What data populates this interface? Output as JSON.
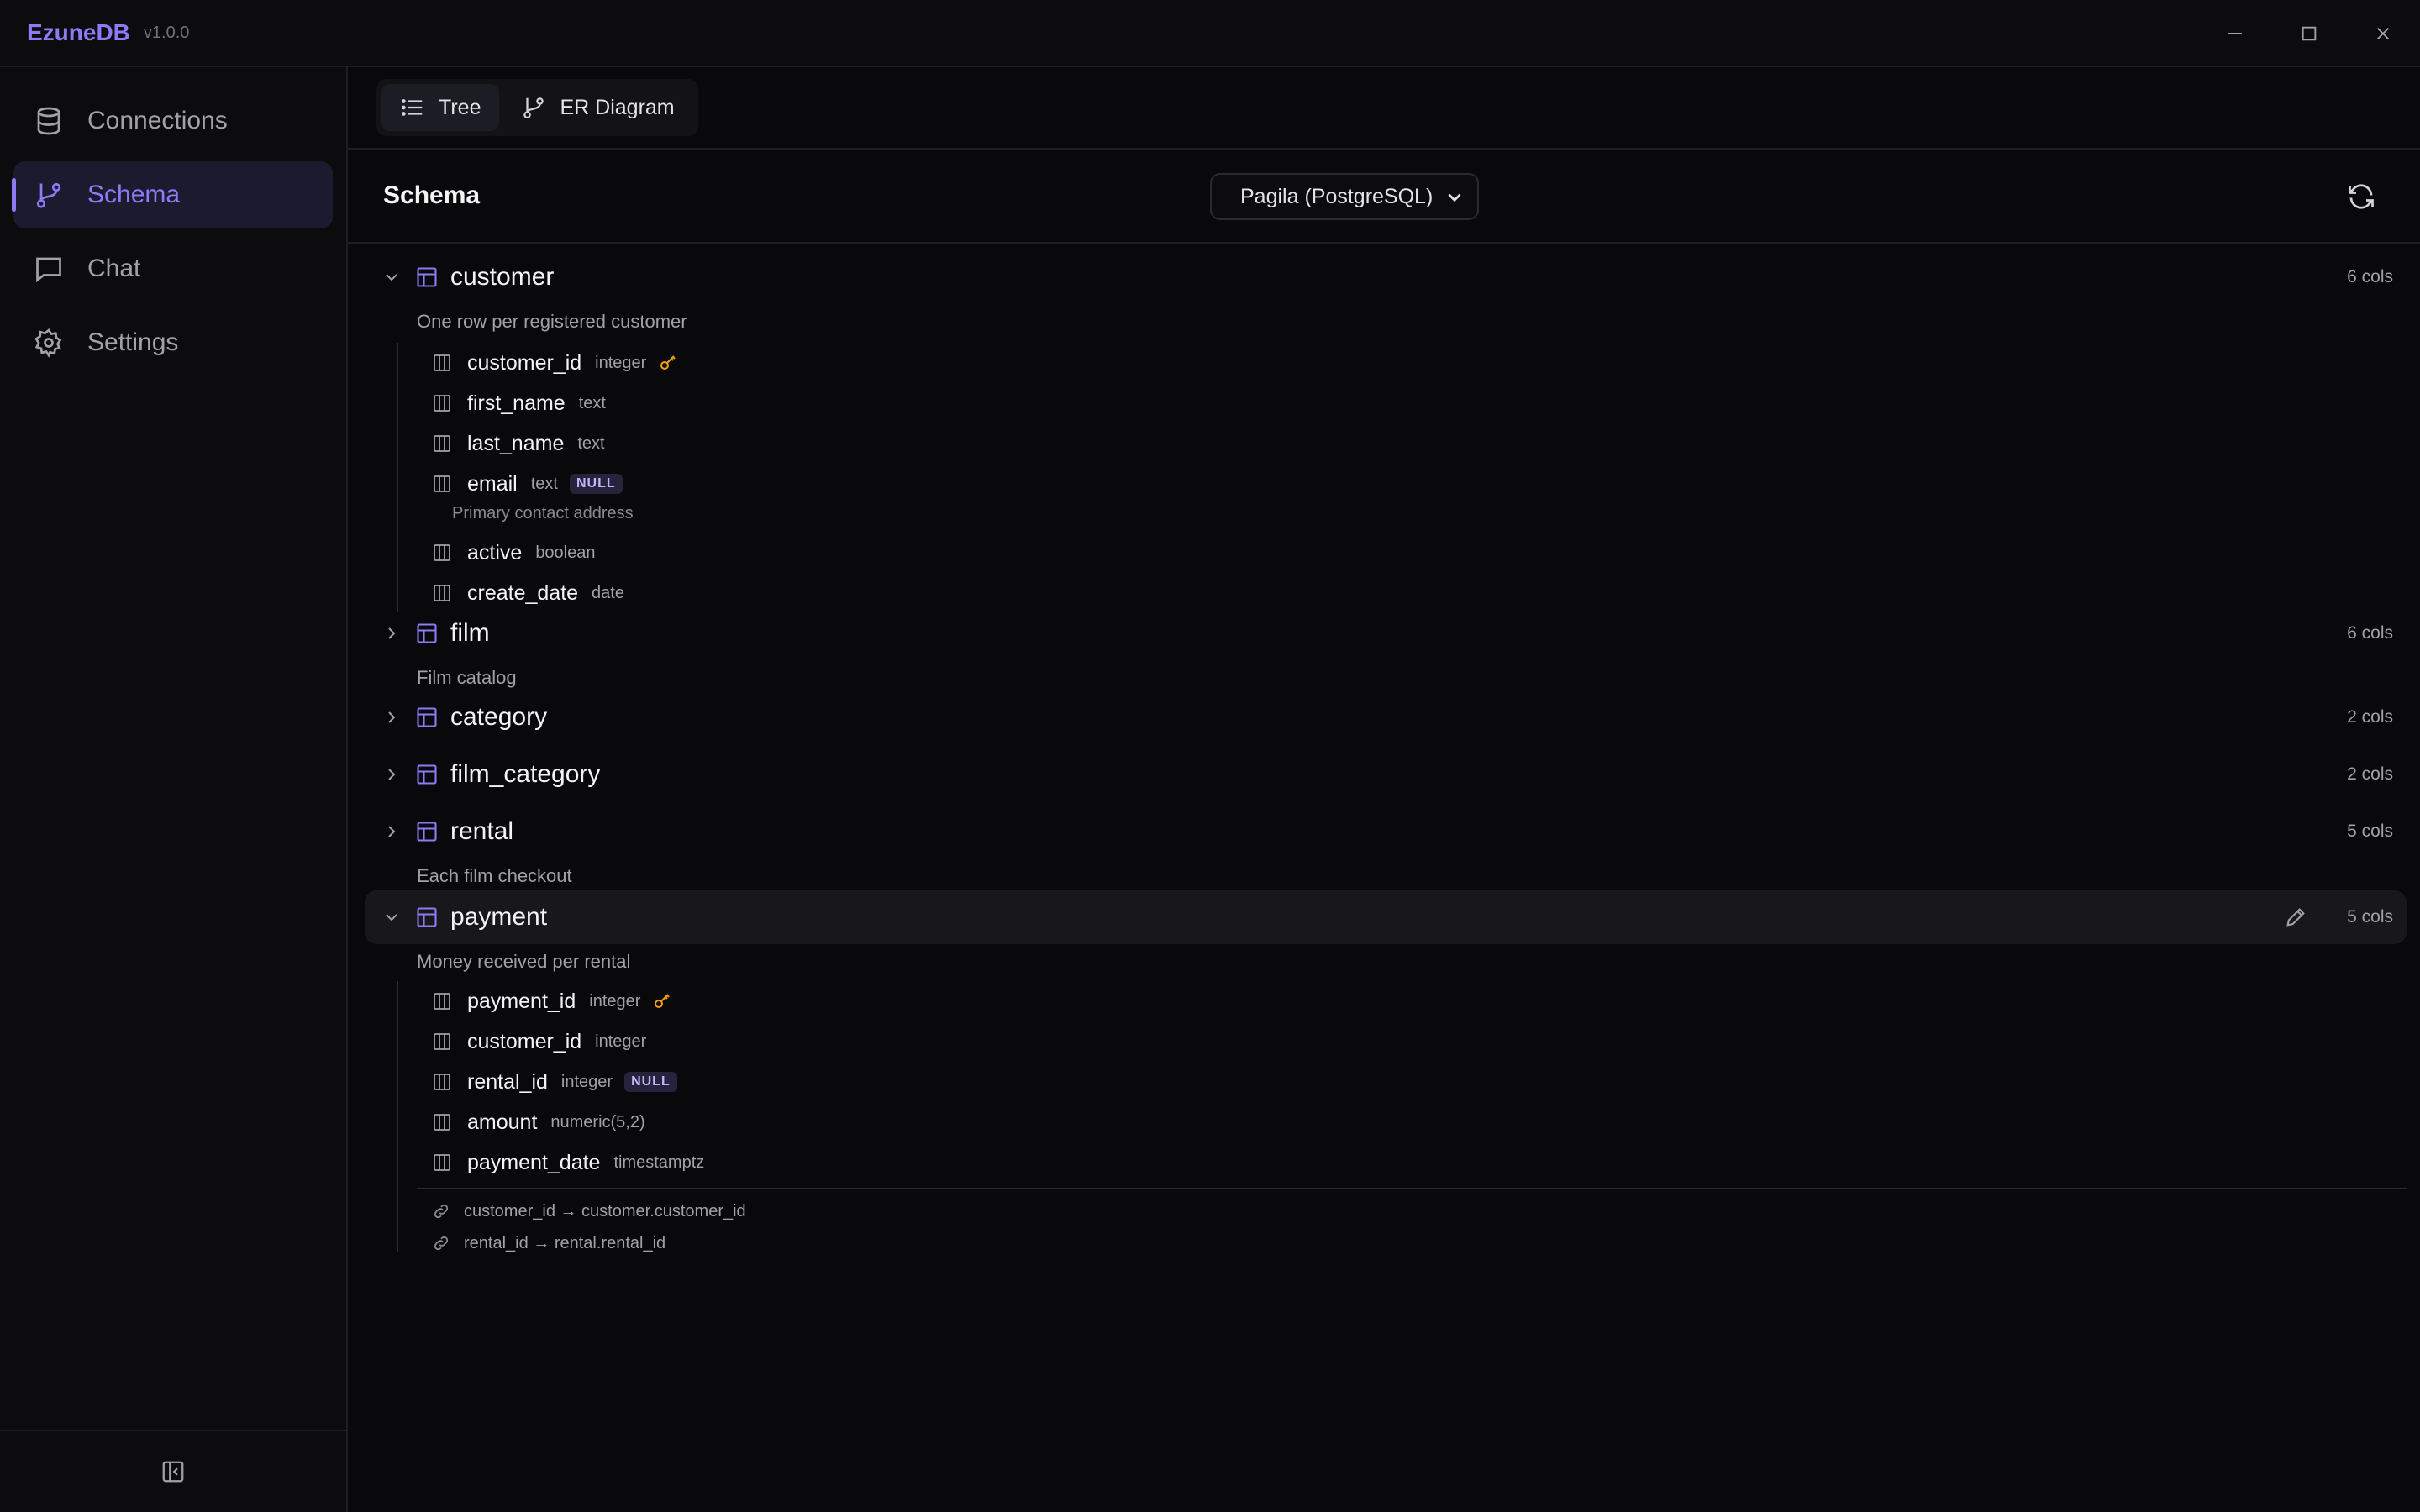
{
  "app": {
    "name": "EzuneDB",
    "version": "v1.0.0"
  },
  "sidebar": {
    "items": [
      {
        "label": "Connections",
        "icon": "database-icon"
      },
      {
        "label": "Schema",
        "icon": "git-branch-icon",
        "active": true
      },
      {
        "label": "Chat",
        "icon": "chat-icon"
      },
      {
        "label": "Settings",
        "icon": "gear-icon"
      }
    ]
  },
  "toolbar": {
    "tabs": [
      {
        "label": "Tree",
        "active": true
      },
      {
        "label": "ER Diagram"
      }
    ]
  },
  "schema": {
    "title": "Schema",
    "connection": "Pagila (PostgreSQL)",
    "tables": [
      {
        "name": "customer",
        "cols": "6 cols",
        "expanded": true,
        "description": "One row per registered customer",
        "columns": [
          {
            "name": "customer_id",
            "type": "integer",
            "pk": true
          },
          {
            "name": "first_name",
            "type": "text"
          },
          {
            "name": "last_name",
            "type": "text"
          },
          {
            "name": "email",
            "type": "text",
            "nullable": "NULL",
            "description": "Primary contact address"
          },
          {
            "name": "active",
            "type": "boolean"
          },
          {
            "name": "create_date",
            "type": "date"
          }
        ]
      },
      {
        "name": "film",
        "cols": "6 cols",
        "description": "Film catalog"
      },
      {
        "name": "category",
        "cols": "2 cols"
      },
      {
        "name": "film_category",
        "cols": "2 cols"
      },
      {
        "name": "rental",
        "cols": "5 cols",
        "description": "Each film checkout"
      },
      {
        "name": "payment",
        "cols": "5 cols",
        "expanded": true,
        "description": "Money received per rental",
        "columns": [
          {
            "name": "payment_id",
            "type": "integer",
            "pk": true
          },
          {
            "name": "customer_id",
            "type": "integer"
          },
          {
            "name": "rental_id",
            "type": "integer",
            "nullable": "NULL"
          },
          {
            "name": "amount",
            "type": "numeric(5,2)"
          },
          {
            "name": "payment_date",
            "type": "timestamptz"
          }
        ],
        "foreign_keys": [
          "customer_id → customer.customer_id",
          "rental_id → rental.rental_id"
        ]
      }
    ]
  },
  "colors": {
    "accent": "#8b7cf6",
    "background": "#09090b",
    "key": "#f59e0b"
  }
}
